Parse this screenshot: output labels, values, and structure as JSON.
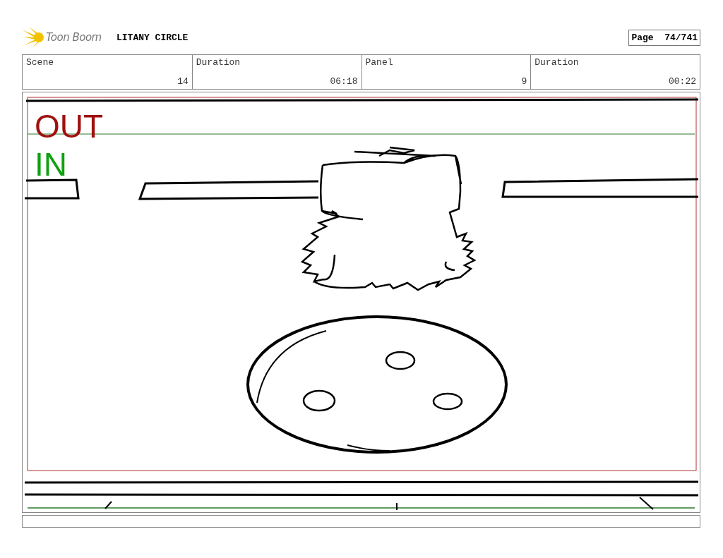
{
  "header": {
    "logo": "Toon Boom",
    "title": "LITANY CIRCLE",
    "page": "Page  74/741"
  },
  "info_cells": [
    {
      "heading": "Scene",
      "entry": "14"
    },
    {
      "heading": "Duration",
      "entry": "06:18"
    },
    {
      "heading": "Panel",
      "entry": "9"
    },
    {
      "heading": "Duration",
      "entry": "00:22"
    }
  ],
  "panel": {
    "markers": [
      {
        "text": "OUT",
        "color": "#a01010"
      },
      {
        "text": "IN",
        "color": "#10a010"
      }
    ]
  }
}
